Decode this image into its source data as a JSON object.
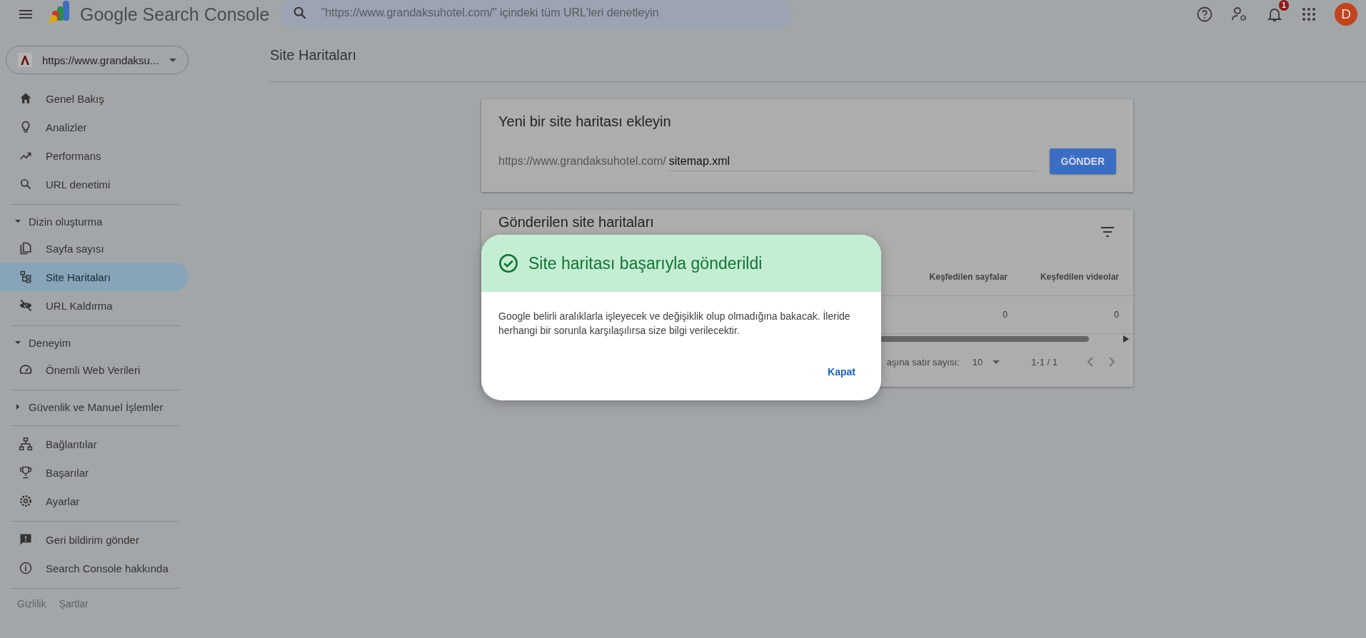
{
  "app": {
    "title": "Google Search Console"
  },
  "search": {
    "placeholder": "\"https://www.grandaksuhotel.com/\" içindeki tüm URL'leri denetleyin"
  },
  "top_actions": {
    "notification_count": "1",
    "avatar": "D"
  },
  "property": {
    "label": "https://www.grandaksu..."
  },
  "nav_groups": [
    {
      "items": [
        {
          "label": "Genel Bakış",
          "selected": false
        },
        {
          "label": "Analizler",
          "selected": false
        },
        {
          "label": "Performans",
          "selected": false
        },
        {
          "label": "URL denetimi",
          "selected": false
        }
      ]
    },
    {
      "heading": "Dizin oluşturma",
      "expanded": true,
      "items": [
        {
          "label": "Sayfa sayısı",
          "selected": false
        },
        {
          "label": "Site Haritaları",
          "selected": true
        },
        {
          "label": "URL Kaldırma",
          "selected": false
        }
      ]
    },
    {
      "heading": "Deneyim",
      "expanded": true,
      "items": [
        {
          "label": "Önemli Web Verileri",
          "selected": false
        }
      ]
    },
    {
      "heading": "Güvenlik ve Manuel İşlemler",
      "expanded": false
    },
    {
      "items": [
        {
          "label": "Bağlantılar",
          "selected": false
        },
        {
          "label": "Başarılar",
          "selected": false
        },
        {
          "label": "Ayarlar",
          "selected": false
        }
      ]
    },
    {
      "items": [
        {
          "label": "Geri bildirim gönder",
          "selected": false
        },
        {
          "label": "Search Console hakkında",
          "selected": false
        }
      ]
    }
  ],
  "footer_links": [
    "Gizlilik",
    "Şartlar"
  ],
  "page_title": "Site Haritaları",
  "add_card": {
    "title": "Yeni bir site haritası ekleyin",
    "prefix": "https://www.grandaksuhotel.com/",
    "value": "sitemap.xml",
    "button": "GÖNDER"
  },
  "submitted_card": {
    "title": "Gönderilen site haritaları",
    "columns": [
      "Keşfedilen sayfalar",
      "Keşfedilen videolar"
    ],
    "rows": [
      [
        "0",
        "0"
      ]
    ],
    "rows_per_page_label": "aşına satır sayısı:",
    "rows_per_page": "10",
    "range": "1-1 / 1"
  },
  "dialog": {
    "title": "Site haritası başarıyla gönderildi",
    "body": "Google belirli aralıklarla işleyecek ve değişiklik olup olmadığına bakacak. İleride herhangi bir sorunla karşılaşılırsa size bilgi verilecektir.",
    "button": "Kapat"
  }
}
